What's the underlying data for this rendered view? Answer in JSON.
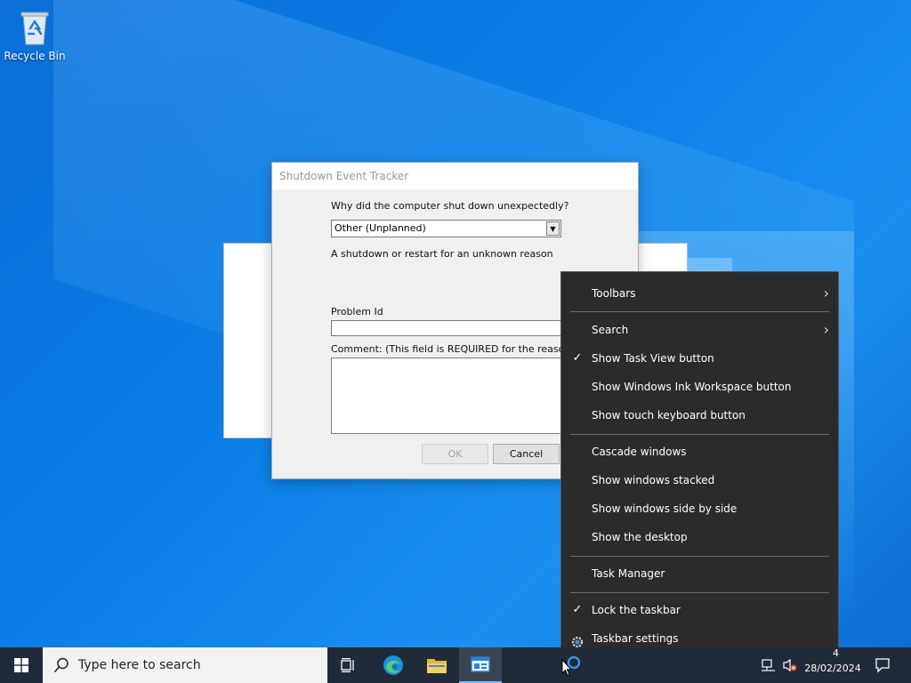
{
  "desktop": {
    "recycle_bin_label": "Recycle Bin"
  },
  "dialog": {
    "title": "Shutdown Event Tracker",
    "question": "Why did the computer shut down unexpectedly?",
    "reason_selected": "Other (Unplanned)",
    "reason_description": "A shutdown or restart for an unknown reason",
    "problem_id_label": "Problem Id",
    "problem_id_value": "",
    "comment_label": "Comment: (This field is REQUIRED for the reason you",
    "comment_value": "",
    "ok_label": "OK",
    "cancel_label": "Cancel"
  },
  "context_menu": {
    "items": [
      {
        "label": "Toolbars",
        "submenu": true,
        "checked": false
      },
      {
        "label": "Search",
        "submenu": true,
        "checked": false
      },
      {
        "label": "Show Task View button",
        "submenu": false,
        "checked": true
      },
      {
        "label": "Show Windows Ink Workspace button",
        "submenu": false,
        "checked": false
      },
      {
        "label": "Show touch keyboard button",
        "submenu": false,
        "checked": false
      },
      {
        "label": "Cascade windows",
        "submenu": false,
        "checked": false
      },
      {
        "label": "Show windows stacked",
        "submenu": false,
        "checked": false
      },
      {
        "label": "Show windows side by side",
        "submenu": false,
        "checked": false
      },
      {
        "label": "Show the desktop",
        "submenu": false,
        "checked": false
      },
      {
        "label": "Task Manager",
        "submenu": false,
        "checked": false
      },
      {
        "label": "Lock the taskbar",
        "submenu": false,
        "checked": true
      },
      {
        "label": "Taskbar settings",
        "submenu": false,
        "checked": false,
        "icon": "gear-icon"
      }
    ],
    "check_glyph": "✓",
    "chevron_glyph": "›"
  },
  "taskbar": {
    "search_placeholder": "Type here to search",
    "clock_time": "4",
    "clock_date": "28/02/2024"
  },
  "colors": {
    "desktop_blue": "#0b7ee6",
    "menu_bg": "#2b2b2b",
    "taskbar_bg": "#1f2b38",
    "accent": "#7ab7ff"
  }
}
